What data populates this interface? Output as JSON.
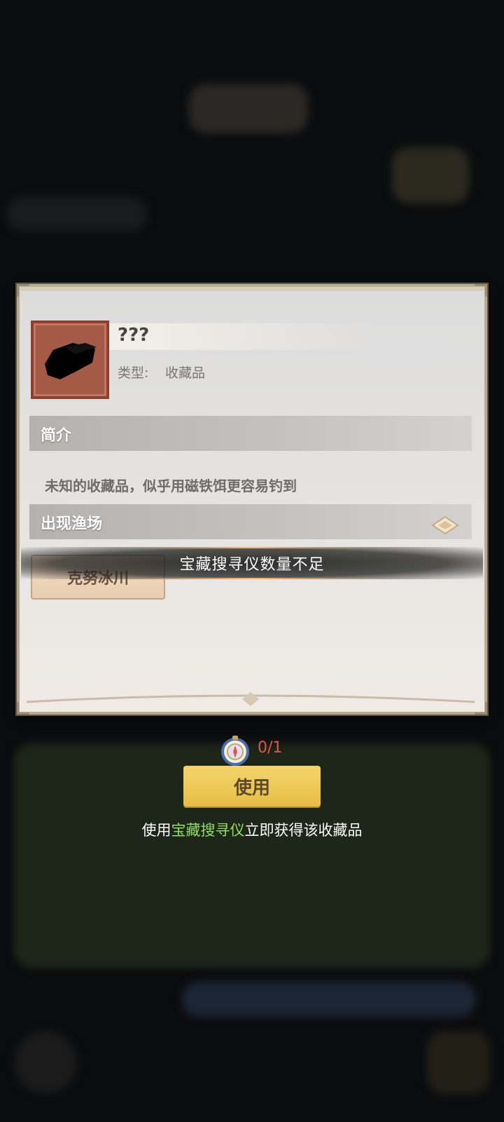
{
  "item": {
    "name": "???",
    "type_label": "类型:",
    "type_value": "收藏品"
  },
  "sections": {
    "intro_title": "简介",
    "intro_text": "未知的收藏品，似乎用磁铁饵更容易钓到",
    "location_title": "出现渔场",
    "location_button": "克努冰川"
  },
  "toast": {
    "message": "宝藏搜寻仪数量不足"
  },
  "use": {
    "count": "0/1",
    "button_label": "使用",
    "hint_prefix": "使用",
    "hint_item": "宝藏搜寻仪",
    "hint_suffix": "立即获得该收藏品"
  },
  "colors": {
    "count": "#e2544b",
    "use_button": "#f0cc5e",
    "hint_highlight": "#8ee05a"
  },
  "icons": {
    "item_icon": "chest-silhouette-icon",
    "toggle_icon": "chevron-diamond-icon",
    "compass_icon": "compass-icon"
  }
}
